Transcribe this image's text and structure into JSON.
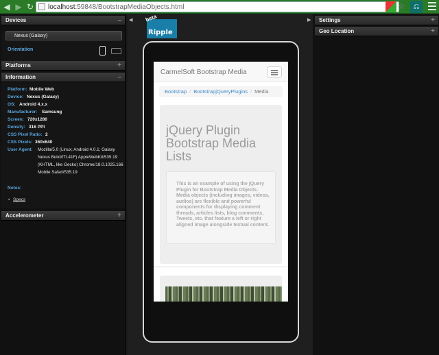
{
  "browser": {
    "url_host": "localhost",
    "url_path": ":59848/BootstrapMediaObjects.html"
  },
  "left": {
    "devices": {
      "header": "Devices",
      "selected_device": "Nexus (Galaxy)",
      "orientation_label": "Orientation"
    },
    "platforms_header": "Platforms",
    "information": {
      "header": "Information",
      "rows": [
        {
          "label": "Platform:",
          "value": "Mobile Web"
        },
        {
          "label": "Device:",
          "value": "Nexus (Galaxy)"
        },
        {
          "label": "OS:",
          "value": "Android 4.x.x"
        },
        {
          "label": "Manufacturer:",
          "value": "Samsung"
        },
        {
          "label": "Screen:",
          "value": "720x1280"
        },
        {
          "label": "Density:",
          "value": "316 PPI"
        },
        {
          "label": "CSS Pixel Ratio:",
          "value": "2"
        },
        {
          "label": "CSS Pixels:",
          "value": "360x640"
        }
      ],
      "user_agent_label": "User Agent:",
      "user_agent_value": "Mozilla/5.0 (Linux; Android 4.0.1; Galaxy Nexus Build/ITL41F) AppleWebKit/535.19 (KHTML, like Gecko) Chrome/18.0.1025.166 Mobile Safari/535.19",
      "notes_label": "Notes:",
      "specs_link": "Specs"
    },
    "accelerometer_header": "Accelerometer"
  },
  "right": {
    "settings_header": "Settings",
    "geo_header": "Geo Location"
  },
  "logo": {
    "beta": "beta",
    "word": "Ripple"
  },
  "device_page": {
    "brand": "CarmelSoft Bootstrap Media",
    "breadcrumb": [
      "Bootstrap",
      "BootstrapjQueryPlugins",
      "Media"
    ],
    "jumbo_title": "jQuery Plugin Bootstrap Media Lists",
    "jumbo_text": "This is an example of using the jQuery Plugin for Bootstrap Media Objects. Media objects (including images, videos, audios) are flexible and powerful components for displaying comment threads, articles lists, blog comments, Tweets, etc. that feature a left or right aligned image alongside textual content."
  },
  "colors": {
    "chrome": "#2a7a28",
    "label_blue": "#5aa7df",
    "link_blue": "#428bca",
    "ripple": "#1a7fa8"
  }
}
